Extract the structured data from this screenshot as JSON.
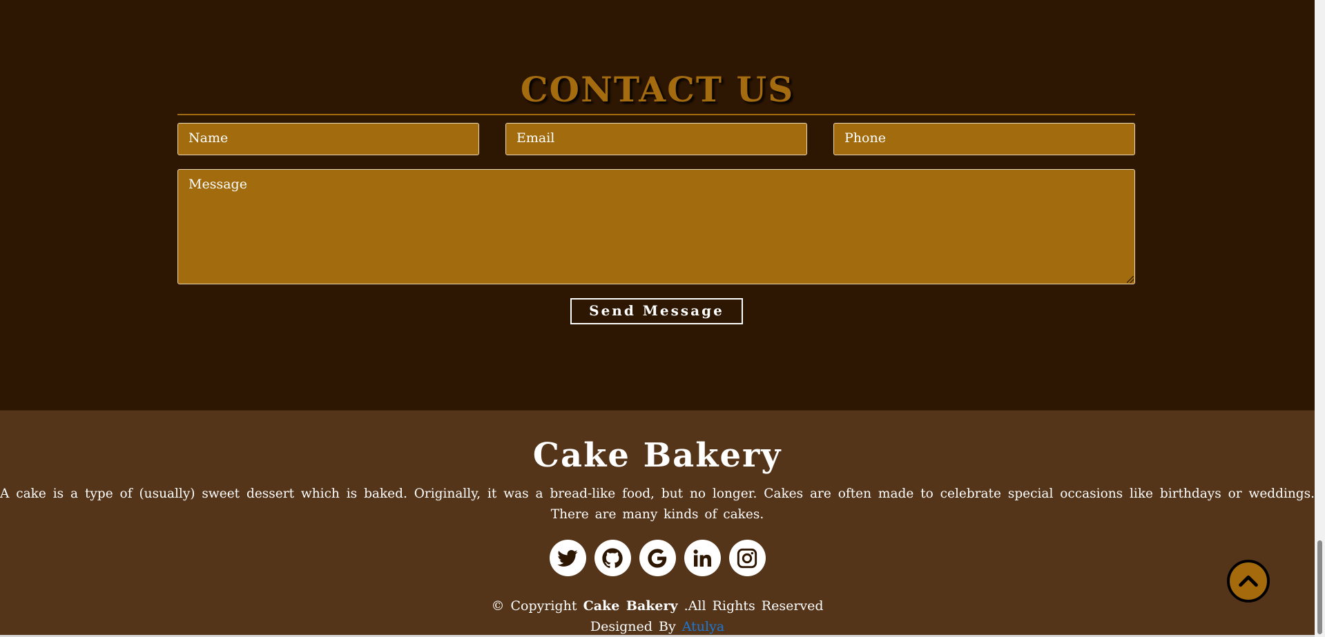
{
  "contact": {
    "title": "CONTACT US",
    "name_placeholder": "Name",
    "email_placeholder": "Email",
    "phone_placeholder": "Phone",
    "message_placeholder": "Message",
    "send_label": "Send Message"
  },
  "footer": {
    "title": "Cake Bakery",
    "description": "A cake is a type of (usually) sweet dessert which is baked. Originally, it was a bread-like food, but no longer. Cakes are often made to celebrate special occasions like birthdays or weddings. There are many kinds of cakes.",
    "social": [
      {
        "icon": "twitter-icon"
      },
      {
        "icon": "github-icon"
      },
      {
        "icon": "google-icon"
      },
      {
        "icon": "linkedin-icon"
      },
      {
        "icon": "instagram-icon"
      }
    ],
    "copyright_prefix": "© Copyright",
    "copyright_brand": "Cake Bakery",
    "copyright_suffix": ".All Rights Reserved",
    "designed_prefix": "Designed By",
    "designer": "Atulya"
  },
  "scroll_top": {
    "icon": "chevron-up-icon"
  },
  "colors": {
    "background": "#2e1702",
    "footer_bg": "#55351a",
    "accent": "#a26c0e",
    "link": "#1a78d8"
  }
}
